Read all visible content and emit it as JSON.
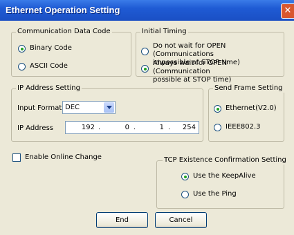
{
  "window": {
    "title": "Ethernet Operation Setting",
    "close_glyph": "✕",
    "icon": "close-icon"
  },
  "communication_data_code": {
    "label": "Communication Data Code",
    "options": [
      {
        "label": "Binary Code",
        "checked": true
      },
      {
        "label": "ASCII Code",
        "checked": false
      }
    ]
  },
  "initial_timing": {
    "label": "Initial Timing",
    "options": [
      {
        "line1": "Do not wait for OPEN (Communications",
        "line2": "impossible at STOP time)",
        "checked": false
      },
      {
        "line1": "Always wait for OPEN (Communication",
        "line2": "possible at STOP time)",
        "checked": true
      }
    ]
  },
  "ip_address_setting": {
    "label": "IP Address Setting",
    "input_format_label": "Input Format",
    "input_format_value": "DEC",
    "ip_address_label": "IP Address",
    "octets": [
      "192",
      "0",
      "1",
      "254"
    ]
  },
  "send_frame_setting": {
    "label": "Send Frame Setting",
    "options": [
      {
        "label": "Ethernet(V2.0)",
        "checked": true
      },
      {
        "label": "IEEE802.3",
        "checked": false
      }
    ]
  },
  "online_change": {
    "label": "Enable Online Change",
    "checked": false
  },
  "tcp_existence": {
    "label": "TCP Existence Confirmation Setting",
    "options": [
      {
        "label": "Use the KeepAlive",
        "checked": true
      },
      {
        "label": "Use the Ping",
        "checked": false
      }
    ]
  },
  "buttons": {
    "end": "End",
    "cancel": "Cancel"
  }
}
